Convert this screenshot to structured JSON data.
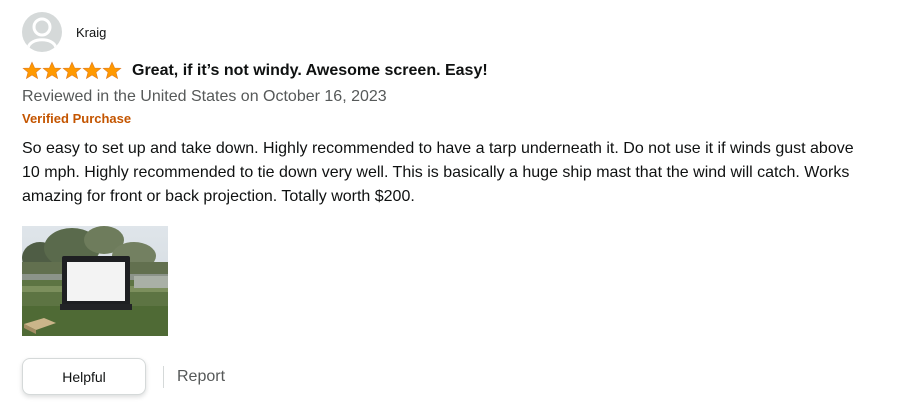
{
  "reviewer": {
    "name": "Kraig",
    "avatar_icon": "default-user-avatar-icon"
  },
  "review": {
    "rating": 5,
    "rating_max": 5,
    "star_icon": "star-icon",
    "star_color": "#ff9900",
    "title": "Great, if it’s not windy. Awesome screen. Easy!",
    "date_text": "Reviewed in the United States on October 16, 2023",
    "badge": "Verified Purchase",
    "badge_color": "#c45500",
    "body": "So easy to set up and take down. Highly recommended to have a tarp underneath it. Do not use it if winds gust above 10 mph. Highly recommended to tie down very well. This is basically a huge ship mast that the wind will catch. Works amazing for front or back projection. Totally worth $200."
  },
  "actions": {
    "helpful_label": "Helpful",
    "report_label": "Report"
  }
}
